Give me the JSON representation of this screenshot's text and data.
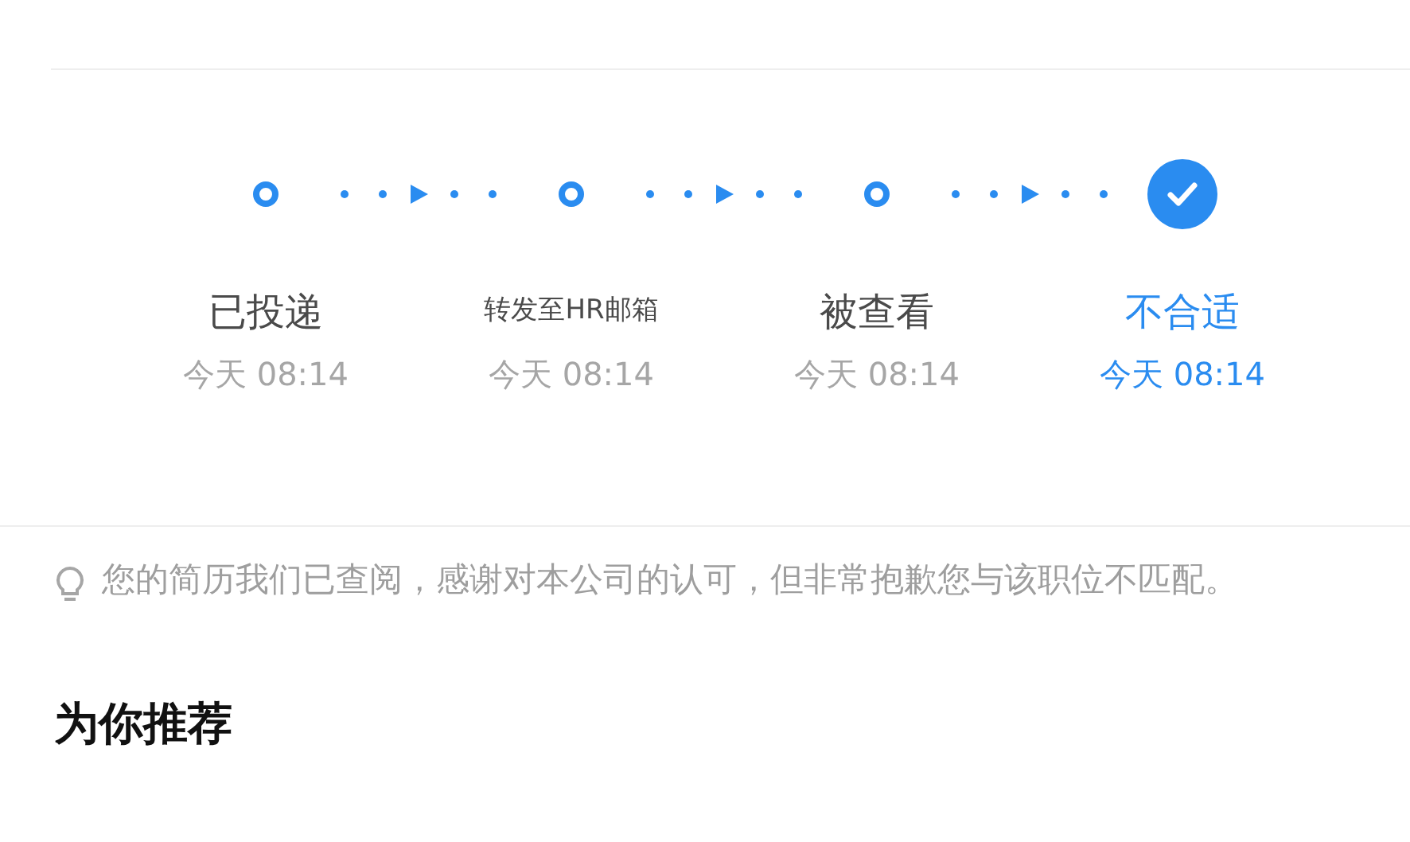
{
  "steps": [
    {
      "label": "已投递",
      "time": "今天 08:14",
      "selected": false
    },
    {
      "label": "转发至HR邮箱",
      "time": "今天 08:14",
      "selected": false
    },
    {
      "label": "被查看",
      "time": "今天 08:14",
      "selected": false
    },
    {
      "label": "不合适",
      "time": "今天 08:14",
      "selected": true
    }
  ],
  "tip": "您的简历我们已查阅，感谢对本公司的认可，但非常抱歉您与该职位不匹配。",
  "section_title": "为你推荐"
}
